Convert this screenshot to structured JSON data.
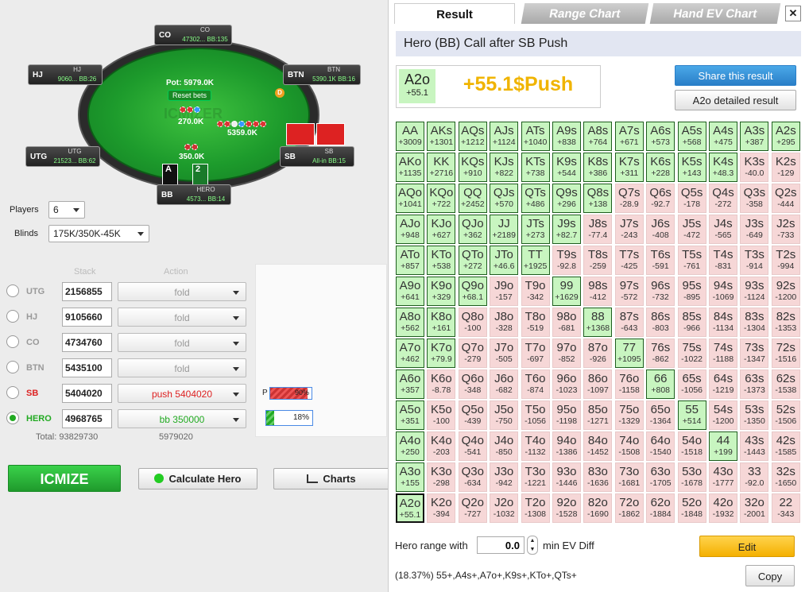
{
  "table": {
    "pot": "Pot: 5979.0K",
    "reset": "Reset bets",
    "bet_mid": "270.0K",
    "bet_right": "5359.0K",
    "bet_hero": "350.0K",
    "dealer": "D",
    "watermark": "ICMIZER",
    "seats": [
      {
        "pos": "CO",
        "name": "CO",
        "stack": "47302... BB:135"
      },
      {
        "pos": "HJ",
        "name": "HJ",
        "stack": "9060... BB:26"
      },
      {
        "pos": "BTN",
        "name": "BTN",
        "stack": "5390.1K BB:16"
      },
      {
        "pos": "UTG",
        "name": "UTG",
        "stack": "21523... BB:62"
      },
      {
        "pos": "SB",
        "name": "SB",
        "stack": "All-in BB:15"
      },
      {
        "pos": "BB",
        "name": "HERO",
        "stack": "4573... BB:14"
      }
    ],
    "hero_cards": [
      "A",
      "2"
    ]
  },
  "settings": {
    "players_label": "Players",
    "players_value": "6",
    "blinds_label": "Blinds",
    "blinds_value": "175K/350K-45K"
  },
  "grid_headers": {
    "stack": "Stack",
    "action": "Action"
  },
  "rows": [
    {
      "pos": "UTG",
      "stack": "2156855",
      "action": "fold",
      "color": "#999"
    },
    {
      "pos": "HJ",
      "stack": "9105660",
      "action": "fold",
      "color": "#999"
    },
    {
      "pos": "CO",
      "stack": "4734760",
      "action": "fold",
      "color": "#999"
    },
    {
      "pos": "BTN",
      "stack": "5435100",
      "action": "fold",
      "color": "#999"
    },
    {
      "pos": "SB",
      "stack": "5404020",
      "action": "push 5404020",
      "color": "#d22"
    },
    {
      "pos": "HERO",
      "stack": "4968765",
      "action": "bb 350000",
      "color": "#2a2"
    }
  ],
  "totals": {
    "total": "Total: 93829730",
    "pot": "5979020"
  },
  "ranges": {
    "p_label": "P",
    "p_value": "90%",
    "hero_value": "18%",
    "p_pct": 90,
    "hero_pct": 18
  },
  "buttons": {
    "icmize": "ICMIZE",
    "calc": "Calculate Hero",
    "charts": "Charts"
  },
  "panel": {
    "tabs": [
      "Result",
      "Range Chart",
      "Hand EV Chart"
    ],
    "close": "✕",
    "title": "Hero (BB) Call after SB Push",
    "hand": "A2o",
    "hand_ev": "+55.1",
    "result": "+55.1$Push",
    "share": "Share this result",
    "detailed": "A2o detailed result",
    "hero_range_label": "Hero range with",
    "min_ev_value": "0.0",
    "min_ev_label": "min EV Diff",
    "edit": "Edit",
    "summary": "(18.37%) 55+,A4s+,A7o+,K9s+,KTo+,QTs+",
    "copy": "Copy"
  },
  "matrix": [
    [
      [
        "AA",
        "+3009",
        1
      ],
      [
        "AKs",
        "+1301",
        1
      ],
      [
        "AQs",
        "+1212",
        1
      ],
      [
        "AJs",
        "+1124",
        1
      ],
      [
        "ATs",
        "+1040",
        1
      ],
      [
        "A9s",
        "+838",
        1
      ],
      [
        "A8s",
        "+764",
        1
      ],
      [
        "A7s",
        "+671",
        1
      ],
      [
        "A6s",
        "+573",
        1
      ],
      [
        "A5s",
        "+568",
        1
      ],
      [
        "A4s",
        "+475",
        1
      ],
      [
        "A3s",
        "+387",
        1
      ],
      [
        "A2s",
        "+295",
        1
      ]
    ],
    [
      [
        "AKo",
        "+1135",
        1
      ],
      [
        "KK",
        "+2716",
        1
      ],
      [
        "KQs",
        "+910",
        1
      ],
      [
        "KJs",
        "+822",
        1
      ],
      [
        "KTs",
        "+738",
        1
      ],
      [
        "K9s",
        "+544",
        1
      ],
      [
        "K8s",
        "+386",
        1
      ],
      [
        "K7s",
        "+311",
        1
      ],
      [
        "K6s",
        "+228",
        1
      ],
      [
        "K5s",
        "+143",
        1
      ],
      [
        "K4s",
        "+48.3",
        1
      ],
      [
        "K3s",
        "-40.0",
        0
      ],
      [
        "K2s",
        "-129",
        0
      ]
    ],
    [
      [
        "AQo",
        "+1041",
        1
      ],
      [
        "KQo",
        "+722",
        1
      ],
      [
        "QQ",
        "+2452",
        1
      ],
      [
        "QJs",
        "+570",
        1
      ],
      [
        "QTs",
        "+486",
        1
      ],
      [
        "Q9s",
        "+296",
        1
      ],
      [
        "Q8s",
        "+138",
        1
      ],
      [
        "Q7s",
        "-28.9",
        0
      ],
      [
        "Q6s",
        "-92.7",
        0
      ],
      [
        "Q5s",
        "-178",
        0
      ],
      [
        "Q4s",
        "-272",
        0
      ],
      [
        "Q3s",
        "-358",
        0
      ],
      [
        "Q2s",
        "-444",
        0
      ]
    ],
    [
      [
        "AJo",
        "+948",
        1
      ],
      [
        "KJo",
        "+627",
        1
      ],
      [
        "QJo",
        "+362",
        1
      ],
      [
        "JJ",
        "+2189",
        1
      ],
      [
        "JTs",
        "+273",
        1
      ],
      [
        "J9s",
        "+82.7",
        1
      ],
      [
        "J8s",
        "-77.4",
        0
      ],
      [
        "J7s",
        "-243",
        0
      ],
      [
        "J6s",
        "-408",
        0
      ],
      [
        "J5s",
        "-472",
        0
      ],
      [
        "J4s",
        "-565",
        0
      ],
      [
        "J3s",
        "-649",
        0
      ],
      [
        "J2s",
        "-733",
        0
      ]
    ],
    [
      [
        "ATo",
        "+857",
        1
      ],
      [
        "KTo",
        "+538",
        1
      ],
      [
        "QTo",
        "+272",
        1
      ],
      [
        "JTo",
        "+46.6",
        1
      ],
      [
        "TT",
        "+1925",
        1
      ],
      [
        "T9s",
        "-92.8",
        0
      ],
      [
        "T8s",
        "-259",
        0
      ],
      [
        "T7s",
        "-425",
        0
      ],
      [
        "T6s",
        "-591",
        0
      ],
      [
        "T5s",
        "-761",
        0
      ],
      [
        "T4s",
        "-831",
        0
      ],
      [
        "T3s",
        "-914",
        0
      ],
      [
        "T2s",
        "-994",
        0
      ]
    ],
    [
      [
        "A9o",
        "+641",
        1
      ],
      [
        "K9o",
        "+329",
        1
      ],
      [
        "Q9o",
        "+68.1",
        1
      ],
      [
        "J9o",
        "-157",
        0
      ],
      [
        "T9o",
        "-342",
        0
      ],
      [
        "99",
        "+1629",
        1
      ],
      [
        "98s",
        "-412",
        0
      ],
      [
        "97s",
        "-572",
        0
      ],
      [
        "96s",
        "-732",
        0
      ],
      [
        "95s",
        "-895",
        0
      ],
      [
        "94s",
        "-1069",
        0
      ],
      [
        "93s",
        "-1124",
        0
      ],
      [
        "92s",
        "-1200",
        0
      ]
    ],
    [
      [
        "A8o",
        "+562",
        1
      ],
      [
        "K8o",
        "+161",
        1
      ],
      [
        "Q8o",
        "-100",
        0
      ],
      [
        "J8o",
        "-328",
        0
      ],
      [
        "T8o",
        "-519",
        0
      ],
      [
        "98o",
        "-681",
        0
      ],
      [
        "88",
        "+1368",
        1
      ],
      [
        "87s",
        "-643",
        0
      ],
      [
        "86s",
        "-803",
        0
      ],
      [
        "85s",
        "-966",
        0
      ],
      [
        "84s",
        "-1134",
        0
      ],
      [
        "83s",
        "-1304",
        0
      ],
      [
        "82s",
        "-1353",
        0
      ]
    ],
    [
      [
        "A7o",
        "+462",
        1
      ],
      [
        "K7o",
        "+79.9",
        1
      ],
      [
        "Q7o",
        "-279",
        0
      ],
      [
        "J7o",
        "-505",
        0
      ],
      [
        "T7o",
        "-697",
        0
      ],
      [
        "97o",
        "-852",
        0
      ],
      [
        "87o",
        "-926",
        0
      ],
      [
        "77",
        "+1095",
        1
      ],
      [
        "76s",
        "-862",
        0
      ],
      [
        "75s",
        "-1022",
        0
      ],
      [
        "74s",
        "-1188",
        0
      ],
      [
        "73s",
        "-1347",
        0
      ],
      [
        "72s",
        "-1516",
        0
      ]
    ],
    [
      [
        "A6o",
        "+357",
        1
      ],
      [
        "K6o",
        "-8.78",
        0
      ],
      [
        "Q6o",
        "-348",
        0
      ],
      [
        "J6o",
        "-682",
        0
      ],
      [
        "T6o",
        "-874",
        0
      ],
      [
        "96o",
        "-1023",
        0
      ],
      [
        "86o",
        "-1097",
        0
      ],
      [
        "76o",
        "-1158",
        0
      ],
      [
        "66",
        "+808",
        1
      ],
      [
        "65s",
        "-1056",
        0
      ],
      [
        "64s",
        "-1219",
        0
      ],
      [
        "63s",
        "-1373",
        0
      ],
      [
        "62s",
        "-1538",
        0
      ]
    ],
    [
      [
        "A5o",
        "+351",
        1
      ],
      [
        "K5o",
        "-100",
        0
      ],
      [
        "Q5o",
        "-439",
        0
      ],
      [
        "J5o",
        "-750",
        0
      ],
      [
        "T5o",
        "-1056",
        0
      ],
      [
        "95o",
        "-1198",
        0
      ],
      [
        "85o",
        "-1271",
        0
      ],
      [
        "75o",
        "-1329",
        0
      ],
      [
        "65o",
        "-1364",
        0
      ],
      [
        "55",
        "+514",
        1
      ],
      [
        "54s",
        "-1200",
        0
      ],
      [
        "53s",
        "-1350",
        0
      ],
      [
        "52s",
        "-1506",
        0
      ]
    ],
    [
      [
        "A4o",
        "+250",
        1
      ],
      [
        "K4o",
        "-203",
        0
      ],
      [
        "Q4o",
        "-541",
        0
      ],
      [
        "J4o",
        "-850",
        0
      ],
      [
        "T4o",
        "-1132",
        0
      ],
      [
        "94o",
        "-1386",
        0
      ],
      [
        "84o",
        "-1452",
        0
      ],
      [
        "74o",
        "-1508",
        0
      ],
      [
        "64o",
        "-1540",
        0
      ],
      [
        "54o",
        "-1518",
        0
      ],
      [
        "44",
        "+199",
        1
      ],
      [
        "43s",
        "-1443",
        0
      ],
      [
        "42s",
        "-1585",
        0
      ]
    ],
    [
      [
        "A3o",
        "+155",
        1
      ],
      [
        "K3o",
        "-298",
        0
      ],
      [
        "Q3o",
        "-634",
        0
      ],
      [
        "J3o",
        "-942",
        0
      ],
      [
        "T3o",
        "-1221",
        0
      ],
      [
        "93o",
        "-1446",
        0
      ],
      [
        "83o",
        "-1636",
        0
      ],
      [
        "73o",
        "-1681",
        0
      ],
      [
        "63o",
        "-1705",
        0
      ],
      [
        "53o",
        "-1678",
        0
      ],
      [
        "43o",
        "-1777",
        0
      ],
      [
        "33",
        "-92.0",
        0
      ],
      [
        "32s",
        "-1650",
        0
      ]
    ],
    [
      [
        "A2o",
        "+55.1",
        1
      ],
      [
        "K2o",
        "-394",
        0
      ],
      [
        "Q2o",
        "-727",
        0
      ],
      [
        "J2o",
        "-1032",
        0
      ],
      [
        "T2o",
        "-1308",
        0
      ],
      [
        "92o",
        "-1528",
        0
      ],
      [
        "82o",
        "-1690",
        0
      ],
      [
        "72o",
        "-1862",
        0
      ],
      [
        "62o",
        "-1884",
        0
      ],
      [
        "52o",
        "-1848",
        0
      ],
      [
        "42o",
        "-1932",
        0
      ],
      [
        "32o",
        "-2001",
        0
      ],
      [
        "22",
        "-343",
        0
      ]
    ]
  ]
}
